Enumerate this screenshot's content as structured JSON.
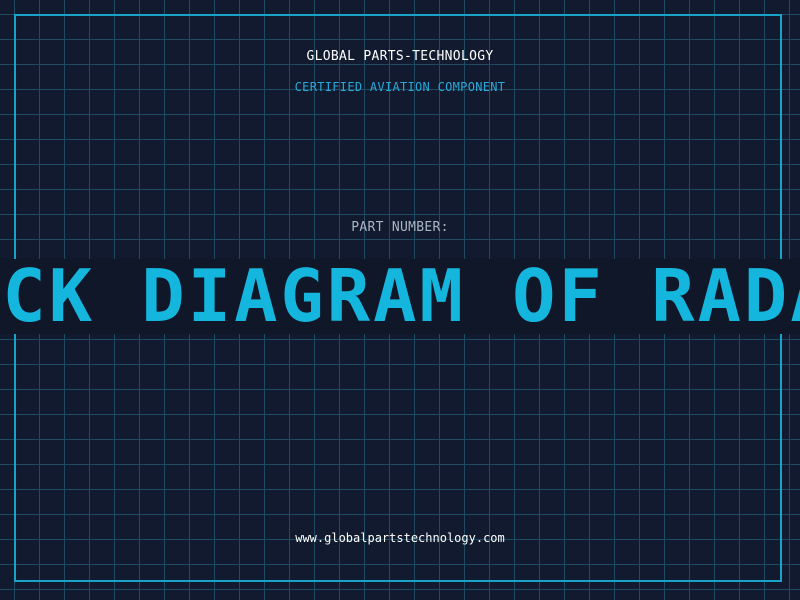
{
  "header": {
    "company": "GLOBAL PARTS-TECHNOLOGY",
    "subtitle": "CERTIFIED AVIATION COMPONENT"
  },
  "part": {
    "label": "PART NUMBER:",
    "value": "OCK DIAGRAM OF RADA"
  },
  "footer": {
    "url": "www.globalpartstechnology.com"
  },
  "colors": {
    "background": "#111a2e",
    "grid": "#1f4b63",
    "frame": "#1aa3c9",
    "accent": "#15b6de",
    "text": "#ffffff",
    "muted": "#a9b6c6"
  }
}
